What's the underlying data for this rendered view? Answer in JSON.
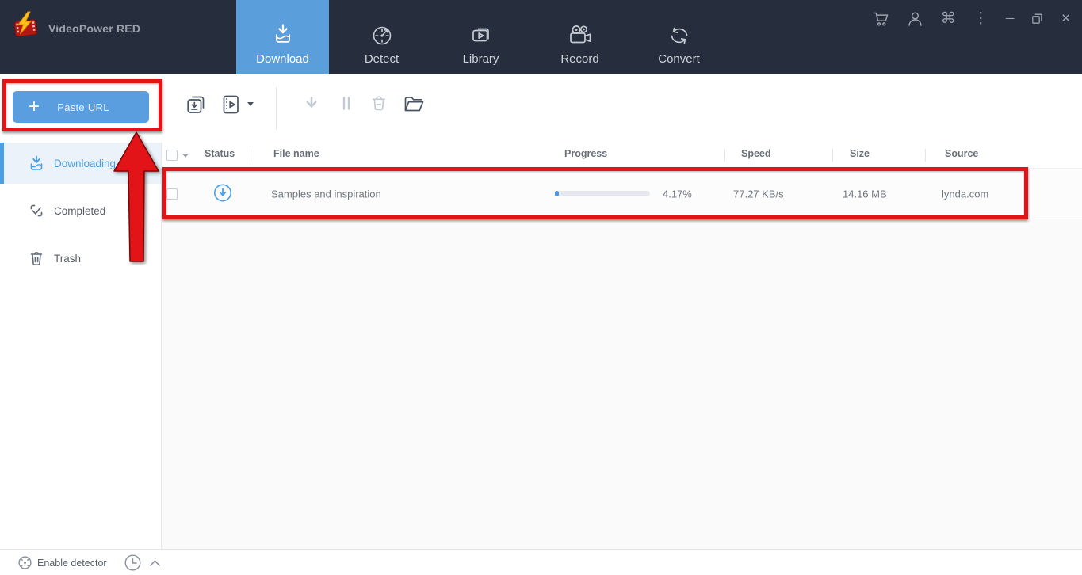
{
  "app": {
    "title": "VideoPower RED"
  },
  "topbar": {
    "tabs": [
      {
        "label": "Download",
        "active": true
      },
      {
        "label": "Detect",
        "active": false
      },
      {
        "label": "Library",
        "active": false
      },
      {
        "label": "Record",
        "active": false
      },
      {
        "label": "Convert",
        "active": false
      }
    ],
    "window_controls": {
      "apps_glyph": "⌘",
      "more_glyph": "⋮",
      "minimize_glyph": "─",
      "close_glyph": "✕"
    }
  },
  "toolbar": {
    "plus_glyph": "+",
    "paste_url_label": "Paste URL"
  },
  "sidebar": {
    "items": [
      {
        "label": "Downloading",
        "active": true
      },
      {
        "label": "Completed",
        "active": false
      },
      {
        "label": "Trash",
        "active": false
      }
    ]
  },
  "table": {
    "headers": [
      "Status",
      "File name",
      "Progress",
      "Speed",
      "Size",
      "Source"
    ],
    "rows": [
      {
        "file_name": "Samples and inspiration",
        "progress_text": "4.17%",
        "progress_value": 4.17,
        "speed": "77.27 KB/s",
        "size": "14.16 MB",
        "source": "lynda.com",
        "status": "downloading"
      }
    ]
  },
  "statusbar": {
    "enable_detector_label": "Enable detector"
  },
  "colors": {
    "topbar_bg": "#262D3D",
    "accent_blue": "#5B9EDC",
    "progress_fill": "#4E97DB",
    "annotation_red": "#E31418",
    "sidebar_active": "#4C9FE3"
  }
}
